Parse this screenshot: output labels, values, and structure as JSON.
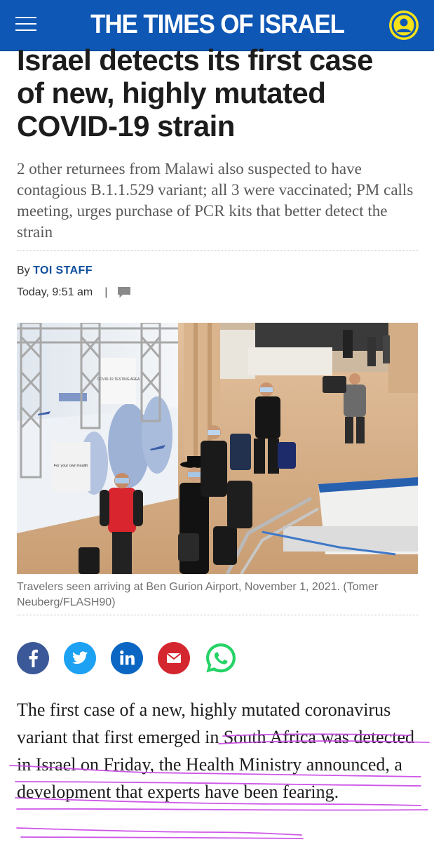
{
  "header": {
    "logo_text": "THE TIMES OF ISRAEL",
    "menu_icon": "hamburger-menu-icon",
    "account_icon": "user-account-icon",
    "brand_color": "#0f57b4",
    "accent_color": "#f5e218"
  },
  "article": {
    "headline_lines": [
      "Israel detects its first case",
      "of new, highly mutated",
      "COVID-19 strain"
    ],
    "subheadline": "2 other returnees from Malawi also suspected to have contagious B.1.1.529 variant; all 3 were vaccinated; PM calls meeting, urges purchase of PCR kits that better detect the strain",
    "byline_prefix": "By",
    "author": "TOI STAFF",
    "timestamp": "Today, 9:51 am",
    "separator": "|",
    "comment_icon": "comment-bubble-icon",
    "photo_caption": "Travelers seen arriving at Ben Gurion Airport, November 1, 2021. (Tomer Neuberg/FLASH90)",
    "body_parts": [
      "The first case of a new, highly mutated coronavirus variant that ",
      "first emerged in South Africa was detected in Israel on Friday, the Health Ministry announced, a development that experts have been fearing."
    ]
  },
  "photo_signage": {
    "signs": [
      "For your own health",
      "COVID-19 TESTING AREA"
    ]
  },
  "share_buttons": [
    {
      "name": "facebook",
      "icon": "facebook-icon",
      "color": "#3b5998"
    },
    {
      "name": "twitter",
      "icon": "twitter-icon",
      "color": "#1da1f2"
    },
    {
      "name": "linkedin",
      "icon": "linkedin-icon",
      "color": "#0a66c2"
    },
    {
      "name": "email",
      "icon": "email-icon",
      "color": "#d4262e"
    },
    {
      "name": "whatsapp",
      "icon": "whatsapp-icon",
      "color": "#25d366"
    }
  ],
  "annotation_color": "#c944e6"
}
